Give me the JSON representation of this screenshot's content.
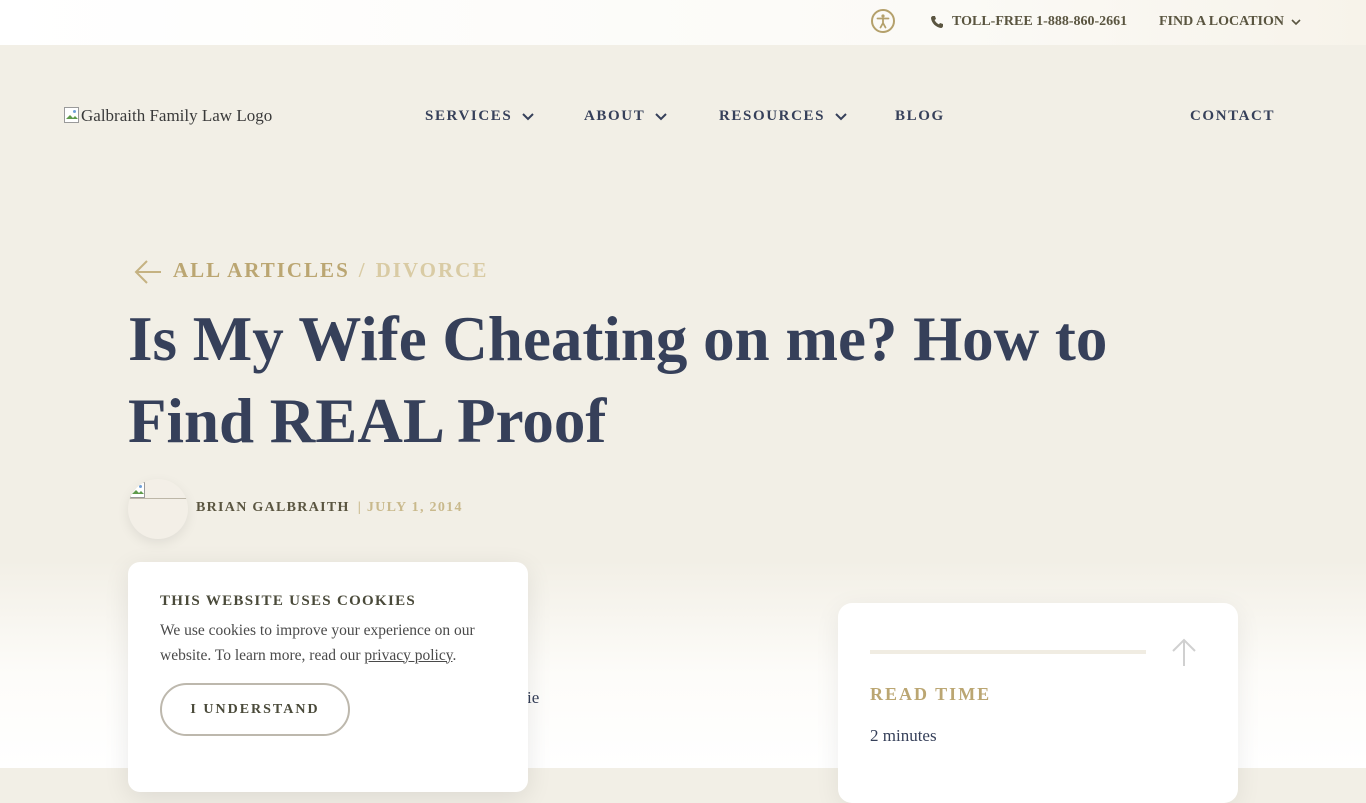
{
  "topbar": {
    "phone_label": "TOLL-FREE 1-888-860-2661",
    "location_label": "FIND A LOCATION"
  },
  "header": {
    "logo_alt": "Galbraith Family Law Logo",
    "nav": {
      "services": "SERVICES",
      "about": "ABOUT",
      "resources": "RESOURCES",
      "blog": "BLOG",
      "contact": "CONTACT"
    }
  },
  "article": {
    "breadcrumb_all": "ALL ARTICLES",
    "breadcrumb_sep": "/",
    "breadcrumb_category": "DIVORCE",
    "title": "Is My Wife Cheating on me? How to Find REAL Proof",
    "author": "BRIAN GALBRAITH",
    "date": "| JULY 1, 2014",
    "body_peek": "ie"
  },
  "cookie_banner": {
    "title": "THIS WEBSITE USES COOKIES",
    "text_before": "We use cookies to improve your experience on our website. To learn more, read our ",
    "link_text": "privacy policy",
    "text_after": ".",
    "button_label": "I UNDERSTAND"
  },
  "read_card": {
    "label": "READ TIME",
    "value": "2 minutes",
    "progress_percent": 0
  },
  "colors": {
    "background": "#f2efe6",
    "navy": "#36405a",
    "gold": "#bba672",
    "gold_light": "#d9cba4",
    "card": "#ffffff"
  },
  "icons": {
    "accessibility": "accessibility-icon",
    "phone": "phone-icon",
    "chevron": "chevron-down-icon",
    "back": "arrow-left-icon",
    "scroll_top": "arrow-up-icon"
  }
}
